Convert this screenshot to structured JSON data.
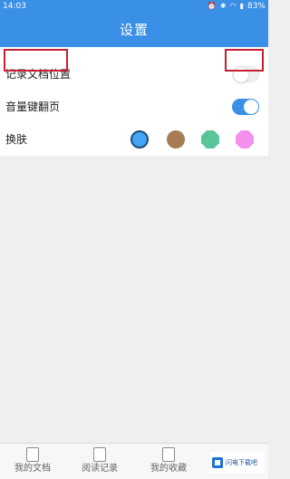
{
  "status_bar": {
    "time": "14:03",
    "battery": "83%",
    "icons": [
      "alarm-icon",
      "bluetooth-icon",
      "vibrate-icon",
      "wifi-icon",
      "signal-icon",
      "battery-icon"
    ]
  },
  "header": {
    "title": "设置",
    "bg_color": "#3a8fe6"
  },
  "settings": {
    "record_position": {
      "label": "记录文档位置",
      "enabled": false
    },
    "volume_page": {
      "label": "音量键翻页",
      "enabled": true
    },
    "skin": {
      "label": "换肤",
      "swatches": [
        {
          "name": "blue",
          "color": "#42a5f5",
          "selected": true,
          "shape": "circle"
        },
        {
          "name": "brown",
          "color": "#a67c52",
          "selected": false,
          "shape": "circle"
        },
        {
          "name": "green",
          "color": "#5bc59a",
          "selected": false,
          "shape": "octagon"
        },
        {
          "name": "pink",
          "color": "#f48ff0",
          "selected": false,
          "shape": "octagon"
        }
      ]
    }
  },
  "bottom_nav": {
    "items": [
      {
        "label": "我的文档",
        "icon": "pdf-document-icon"
      },
      {
        "label": "阅读记录",
        "icon": "book-icon"
      },
      {
        "label": "我的收藏",
        "icon": "favorite-document-icon"
      }
    ]
  },
  "watermark": {
    "text": "闪电下载吧"
  },
  "colors": {
    "accent": "#3a8fe6",
    "highlight_border": "#c81e32"
  }
}
